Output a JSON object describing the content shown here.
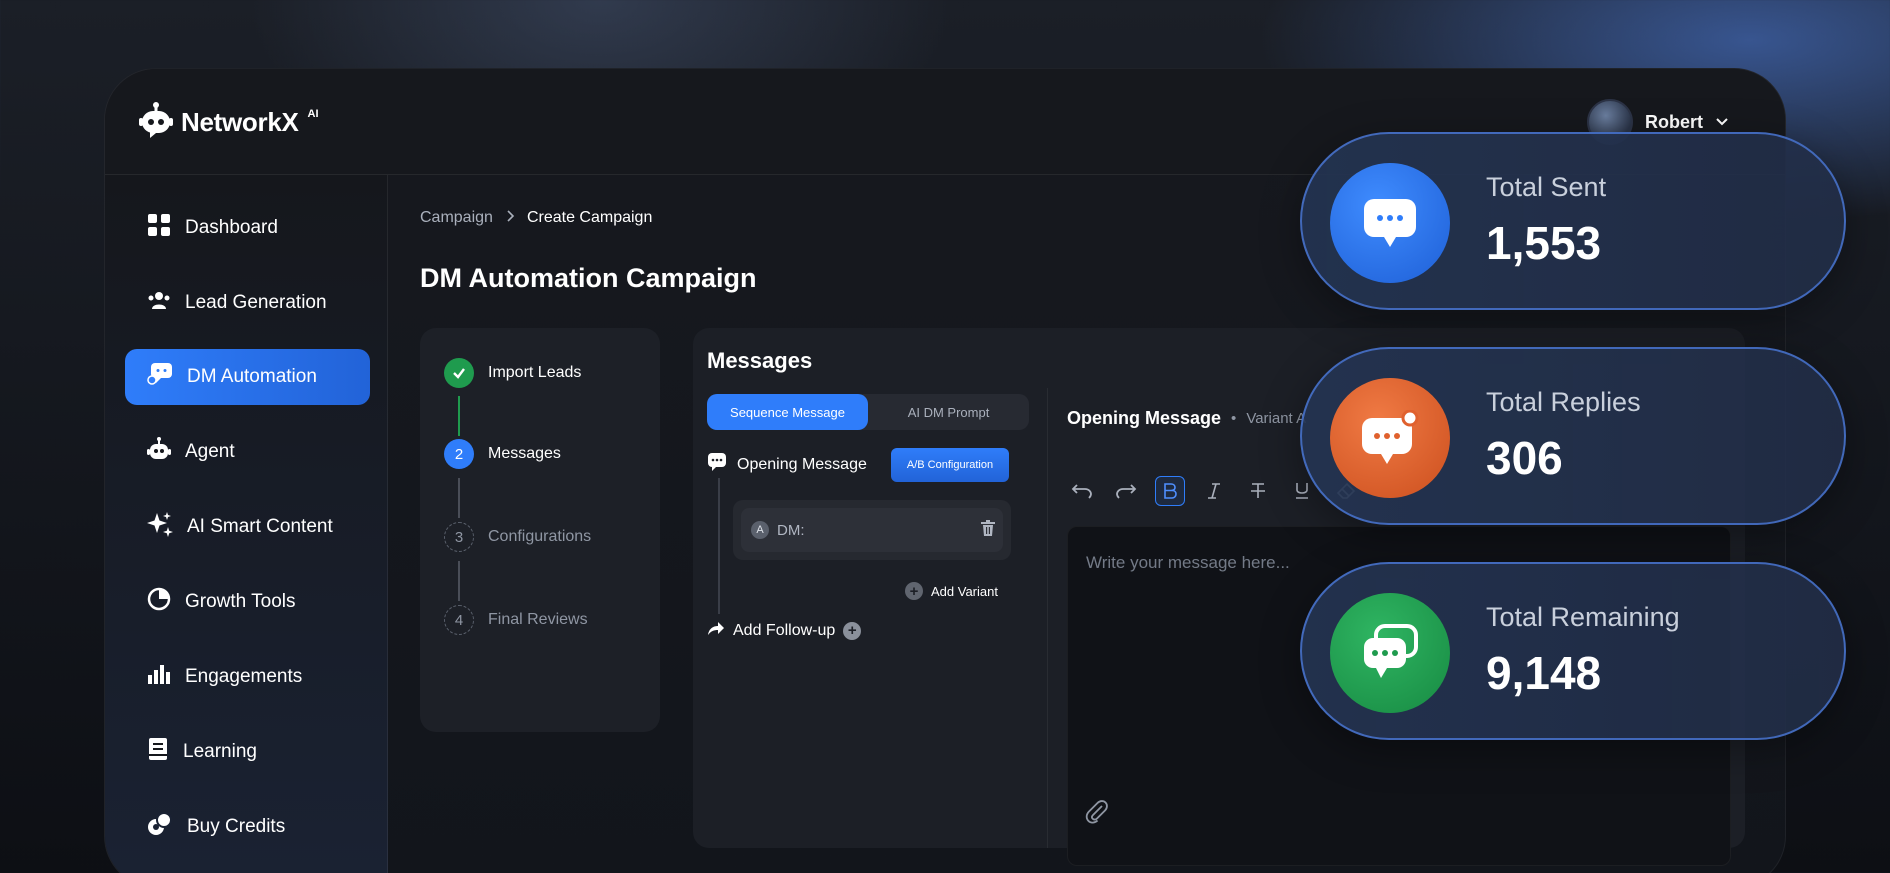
{
  "brand": {
    "name": "NetworkX",
    "suffix": "AI"
  },
  "user": {
    "name": "Robert"
  },
  "sidebar": {
    "items": [
      {
        "label": "Dashboard",
        "icon": "grid-icon"
      },
      {
        "label": "Lead Generation",
        "icon": "users-icon"
      },
      {
        "label": "DM Automation",
        "icon": "chat-bot-icon",
        "active": true
      },
      {
        "label": "Agent",
        "icon": "robot-icon"
      },
      {
        "label": "AI Smart Content",
        "icon": "sparkle-icon"
      },
      {
        "label": "Growth Tools",
        "icon": "pie-icon"
      },
      {
        "label": "Engagements",
        "icon": "bar-chart-icon"
      },
      {
        "label": "Learning",
        "icon": "book-icon"
      },
      {
        "label": "Buy Credits",
        "icon": "coins-icon"
      }
    ]
  },
  "breadcrumb": {
    "parent": "Campaign",
    "current": "Create Campaign"
  },
  "page": {
    "title": "DM Automation Campaign"
  },
  "steps": [
    {
      "label": "Import Leads",
      "state": "done"
    },
    {
      "num": "2",
      "label": "Messages",
      "state": "active"
    },
    {
      "num": "3",
      "label": "Configurations",
      "state": "pending"
    },
    {
      "num": "4",
      "label": "Final Reviews",
      "state": "pending"
    }
  ],
  "messages": {
    "title": "Messages",
    "tabs": [
      "Sequence Message",
      "AI DM Prompt"
    ],
    "opening_label": "Opening Message",
    "ab_button": "A/B Configuration",
    "variant_badge": "A",
    "variant_label": "DM:",
    "add_variant": "Add Variant",
    "add_followup": "Add Follow-up"
  },
  "editor": {
    "title": "Opening Message",
    "variant": "Variant A",
    "placeholder": "Write your message here..."
  },
  "stats": [
    {
      "label": "Total Sent",
      "value": "1,553",
      "color": "#2f7dfa"
    },
    {
      "label": "Total Replies",
      "value": "306",
      "color": "#e0612e"
    },
    {
      "label": "Total Remaining",
      "value": "9,148",
      "color": "#1f9b4e"
    }
  ],
  "colors": {
    "accent": "#2f7dfa",
    "success": "#1f9b4e",
    "warning": "#e0612e"
  }
}
